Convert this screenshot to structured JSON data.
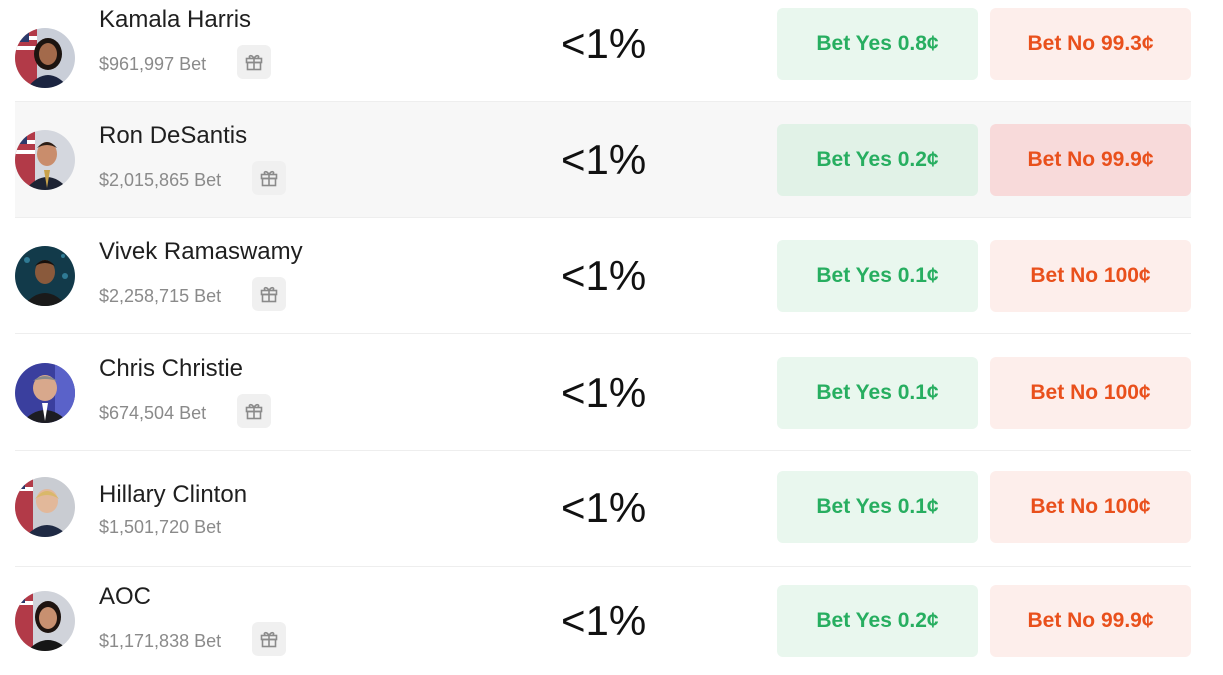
{
  "colors": {
    "yes_text": "#27ae60",
    "yes_bg": "#e9f7ee",
    "no_text": "#e9501c",
    "no_bg": "#fdeeeb",
    "highlight_row_bg": "#f7f7f7"
  },
  "candidates": [
    {
      "name": "Kamala Harris",
      "volume": "$961,997 Bet",
      "chance": "<1%",
      "yes_label": "Bet Yes 0.8¢",
      "no_label": "Bet No 99.3¢",
      "has_gift_icon": true,
      "avatar_icon": "portrait-photo"
    },
    {
      "name": "Ron DeSantis",
      "volume": "$2,015,865 Bet",
      "chance": "<1%",
      "yes_label": "Bet Yes 0.2¢",
      "no_label": "Bet No 99.9¢",
      "has_gift_icon": true,
      "avatar_icon": "portrait-photo"
    },
    {
      "name": "Vivek Ramaswamy",
      "volume": "$2,258,715 Bet",
      "chance": "<1%",
      "yes_label": "Bet Yes 0.1¢",
      "no_label": "Bet No 100¢",
      "has_gift_icon": true,
      "avatar_icon": "portrait-photo"
    },
    {
      "name": "Chris Christie",
      "volume": "$674,504 Bet",
      "chance": "<1%",
      "yes_label": "Bet Yes 0.1¢",
      "no_label": "Bet No 100¢",
      "has_gift_icon": true,
      "avatar_icon": "portrait-photo"
    },
    {
      "name": "Hillary Clinton",
      "volume": "$1,501,720 Bet",
      "chance": "<1%",
      "yes_label": "Bet Yes 0.1¢",
      "no_label": "Bet No 100¢",
      "has_gift_icon": false,
      "avatar_icon": "portrait-photo"
    },
    {
      "name": "AOC",
      "volume": "$1,171,838 Bet",
      "chance": "<1%",
      "yes_label": "Bet Yes 0.2¢",
      "no_label": "Bet No 99.9¢",
      "has_gift_icon": true,
      "avatar_icon": "portrait-photo"
    }
  ]
}
